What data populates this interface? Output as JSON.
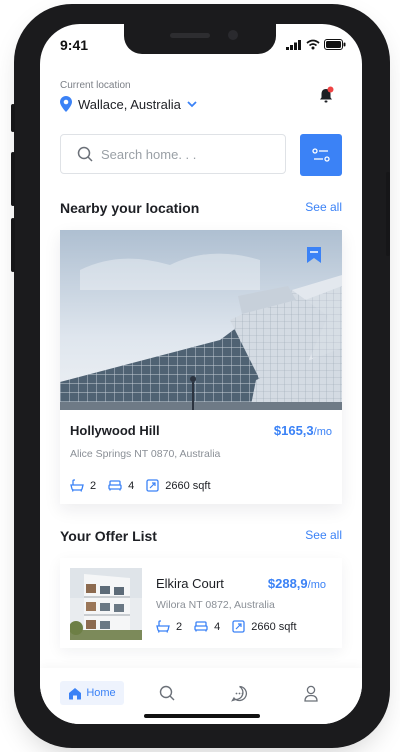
{
  "status_bar": {
    "time": "9:41"
  },
  "header": {
    "current_location_label": "Current location",
    "location": "Wallace, Australia"
  },
  "search": {
    "placeholder": "Search home. . ."
  },
  "nearby": {
    "title": "Nearby your location",
    "see_all": "See all",
    "property": {
      "name": "Hollywood Hill",
      "price": "$165,3",
      "per": "/mo",
      "address": "Alice Springs NT 0870, Australia",
      "baths": "2",
      "beds": "4",
      "area": "2660 sqft"
    }
  },
  "offers": {
    "title": "Your Offer List",
    "see_all": "See all",
    "items": [
      {
        "name": "Elkira Court",
        "price": "$288,9",
        "per": "/mo",
        "address": "Wilora NT 0872, Australia",
        "baths": "2",
        "beds": "4",
        "area": "2660 sqft"
      }
    ]
  },
  "nav": {
    "home_label": "Home"
  },
  "colors": {
    "accent": "#3b82f6",
    "notification_dot": "#ef4444"
  },
  "icons": [
    "location-pin-icon",
    "chevron-down-icon",
    "bell-icon",
    "search-icon",
    "filter-icon",
    "bookmark-icon",
    "bathtub-icon",
    "bed-icon",
    "area-icon",
    "home-icon",
    "chat-icon",
    "profile-icon"
  ]
}
